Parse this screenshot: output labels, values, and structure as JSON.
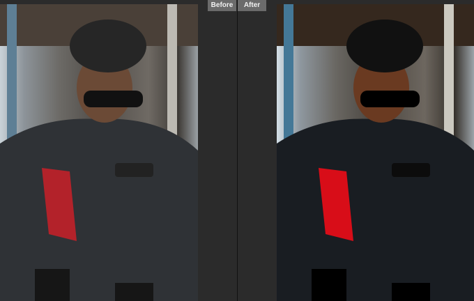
{
  "labels": {
    "before": "Before",
    "after": "After"
  }
}
